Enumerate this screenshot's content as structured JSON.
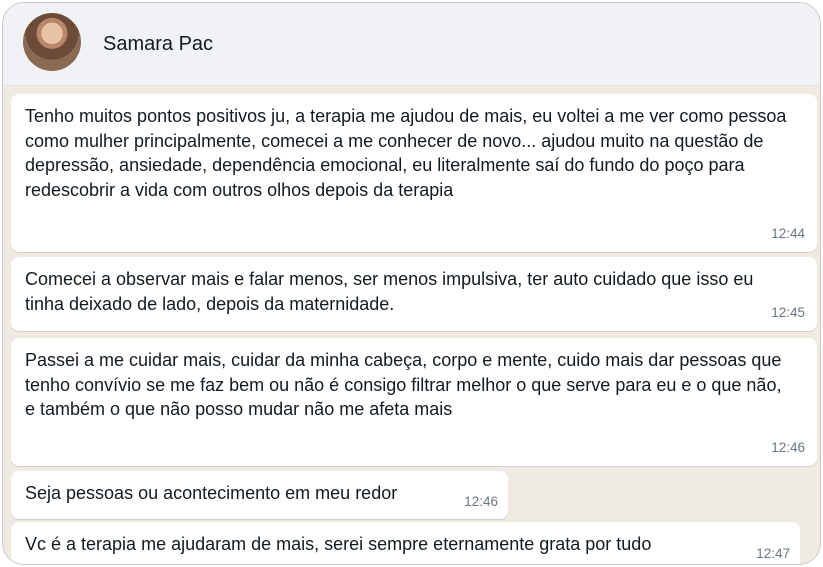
{
  "header": {
    "contact_name": "Samara Pac",
    "avatar": "profile-photo"
  },
  "messages": [
    {
      "text": "Tenho muitos pontos positivos ju, a terapia me ajudou de mais, eu voltei a me ver como pessoa como mulher principalmente, comecei a me conhecer de novo... ajudou muito na questão de depressão, ansiedade, dependência emocional, eu literalmente saí do fundo do poço para redescobrir a vida com outros olhos depois da terapia",
      "time": "12:44"
    },
    {
      "text": "Comecei a observar mais e falar menos, ser menos impulsiva, ter auto cuidado que isso eu tinha deixado de lado, depois da maternidade.",
      "time": "12:45"
    },
    {
      "text": "Passei a me cuidar mais, cuidar da minha cabeça, corpo e mente, cuido mais dar pessoas que tenho convívio se me faz bem ou não é consigo filtrar melhor o que serve para eu e o que não, e também o que não posso mudar não me afeta mais",
      "time": "12:46"
    },
    {
      "text": "Seja pessoas ou acontecimento em meu redor",
      "time": "12:46"
    },
    {
      "text": "Vc é a terapia me ajudaram de mais, serei sempre eternamente grata por tudo",
      "time": "12:47"
    }
  ],
  "colors": {
    "header_bg": "#f0f2f5",
    "chat_bg": "#efeae2",
    "bubble_bg": "#ffffff",
    "timestamp": "#667781"
  }
}
